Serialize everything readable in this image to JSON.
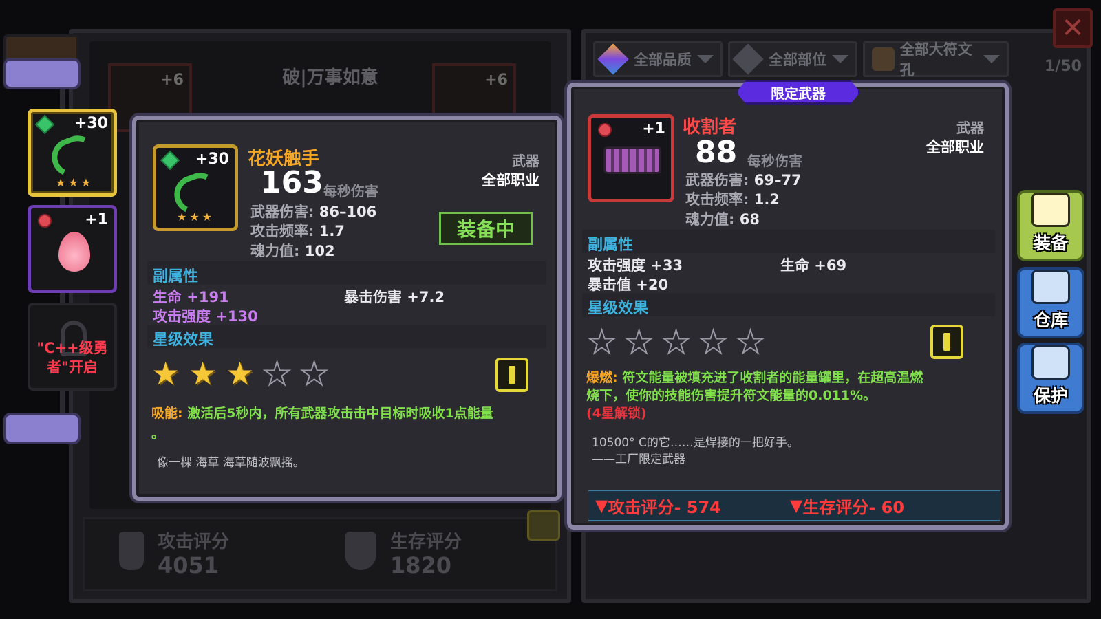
{
  "background": {
    "set_title": "破|万事如意",
    "slot_plus_left": "+6",
    "slot_plus_right": "+6",
    "attack_score_label": "攻击评分",
    "attack_score_value": "4051",
    "survive_score_label": "生存评分",
    "survive_score_value": "1820"
  },
  "filters": [
    {
      "label": "全部品质"
    },
    {
      "label": "全部部位"
    },
    {
      "label": "全部大符文孔"
    }
  ],
  "inventory_count": "1/50",
  "sidebar": {
    "items": [
      {
        "level": "+30",
        "stars": "★★★",
        "name": "tentacle"
      },
      {
        "level": "+1",
        "name": "pink-flame"
      },
      {
        "locked_text_1": "\"C++级勇",
        "locked_text_2": "者\"开启"
      }
    ]
  },
  "equipped": {
    "name": "花妖触手",
    "level": "+30",
    "icon_stars": "★★★",
    "type": "武器",
    "class": "全部职业",
    "dps": "163",
    "dps_label": "每秒伤害",
    "damage_label": "武器伤害:",
    "damage_value": "86–106",
    "rate_label": "攻击频率:",
    "rate_value": "1.7",
    "soul_label": "魂力值:",
    "soul_value": "102",
    "equip_badge": "装备中",
    "sub_attr_label": "副属性",
    "sub_attrs": [
      "生命 +191",
      "暴击伤害 +7.2",
      "攻击强度 +130"
    ],
    "star_label": "星级效果",
    "stars_on": 3,
    "stars_total": 5,
    "effect_name": "吸能",
    "effect_sep": ":",
    "effect_text": "激活后5秒内，所有武器攻击击中目标时吸收1点能量",
    "effect_text_cont": "。",
    "flavor": "像一棵 海草 海草随波飘摇。"
  },
  "compare": {
    "tag": "限定武器",
    "name": "收割者",
    "level": "+1",
    "type": "武器",
    "class": "全部职业",
    "dps": "88",
    "dps_label": "每秒伤害",
    "damage_label": "武器伤害:",
    "damage_value": "69–77",
    "rate_label": "攻击频率:",
    "rate_value": "1.2",
    "soul_label": "魂力值:",
    "soul_value": "68",
    "sub_attr_label": "副属性",
    "sub_attrs": [
      "攻击强度 +33",
      "生命 +69",
      "暴击值 +20"
    ],
    "star_label": "星级效果",
    "stars_on": 0,
    "stars_total": 5,
    "effect_name": "爆燃",
    "effect_sep": ":",
    "effect_text_1": "符文能量被填充进了收割者的能量罐里，在超高温燃",
    "effect_text_2": "烧下，使你的技能伤害提升符文能量的0.011%。",
    "effect_unlock": "(4星解锁)",
    "flavor_1": "10500° C的它……是焊接的一把好手。",
    "flavor_2": "——工厂限定武器",
    "attack_rating": "攻击评分- 574",
    "survive_rating": "生存评分- 60"
  },
  "right_buttons": [
    {
      "label": "装备"
    },
    {
      "label": "仓库"
    },
    {
      "label": "保护"
    }
  ],
  "colors": {
    "equipped_name": "#f5a623",
    "compare_name": "#ff4a4a",
    "section_label": "#3fb3e0",
    "sub_attr_purple": "#c97df0",
    "effect_green": "#7fe04a",
    "effect_orange": "#f5a623",
    "rating_red": "#ff3b3b"
  }
}
